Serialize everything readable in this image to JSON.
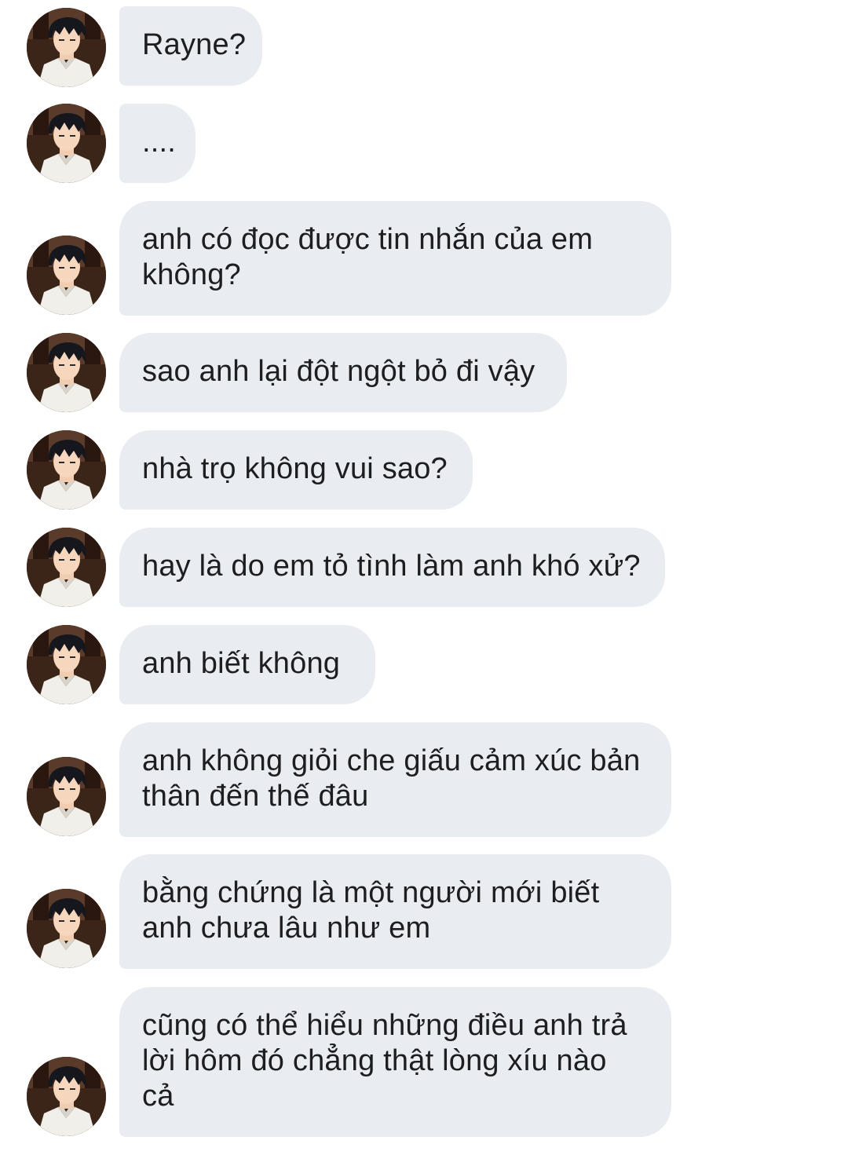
{
  "conversation": {
    "sender_avatar": "male-anime-avatar-icon",
    "bubble_color": "#e9ecf1",
    "text_color": "#1c1e21",
    "messages": [
      {
        "text": "Rayne?"
      },
      {
        "text": "...."
      },
      {
        "text": "anh có đọc được tin nhắn của em\nkhông?"
      },
      {
        "text": "sao anh lại đột ngột bỏ đi vậy"
      },
      {
        "text": "nhà trọ không vui sao?"
      },
      {
        "text": "hay là do em tỏ tình làm anh khó xử?"
      },
      {
        "text": "anh biết không"
      },
      {
        "text": "anh không giỏi che giấu cảm xúc bản\nthân đến thế đâu"
      },
      {
        "text": "bằng chứng là một người mới biết\nanh chưa lâu như em"
      },
      {
        "text": "cũng có thể hiểu những điều anh trả\nlời hôm đó chẳng thật lòng xíu nào\ncả"
      }
    ]
  }
}
